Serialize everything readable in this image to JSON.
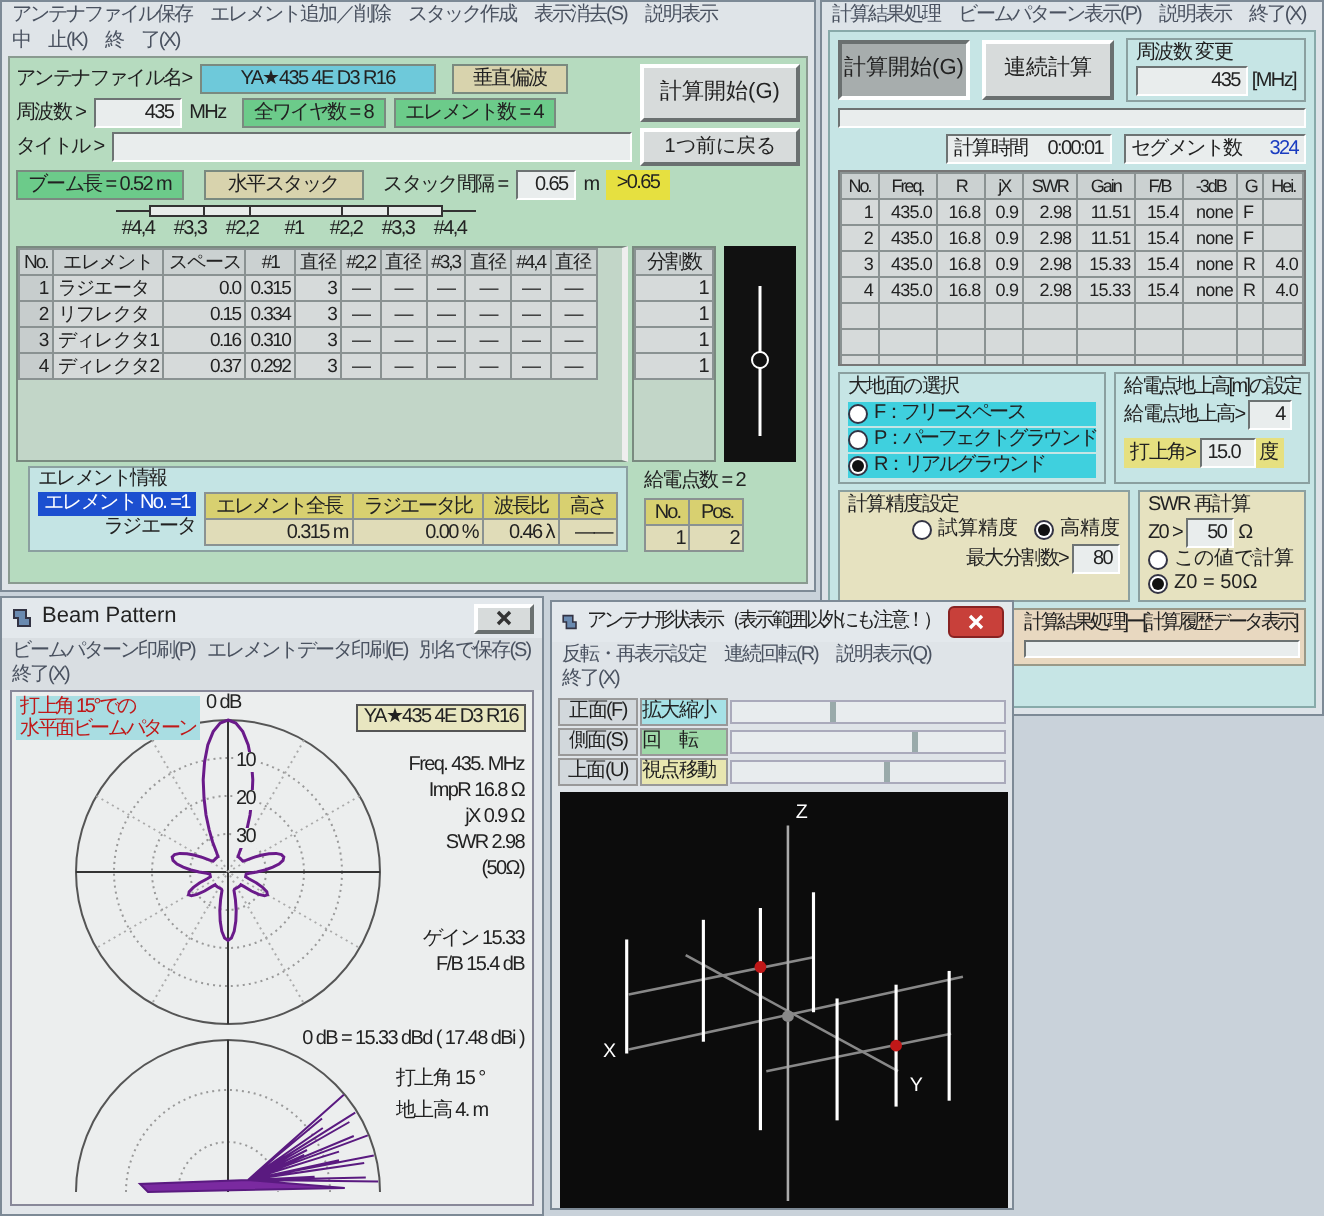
{
  "main_window": {
    "menu": [
      "アンテナファイル保存",
      "エレメント追加／削除",
      "スタック作成",
      "表示消去(S)",
      "説明表示",
      "中　止(K)",
      "終　了(X)"
    ],
    "file": {
      "label": "アンテナファイル名>",
      "value": "YA★435 4E D3 R16"
    },
    "polarization": "垂直偏波",
    "frequency": {
      "label": "周波数 >",
      "value": "435",
      "unit": "MHz"
    },
    "wire_count": "全ワイヤ数 = 8",
    "element_count": "エレメント数 = 4",
    "title_label": "タイトル >",
    "buttons": [
      "計算開始(G)",
      "1つ前に戻る"
    ],
    "boom": "ブーム長 = 0.52 m",
    "stack_type": "水平スタック",
    "stack_spacing": {
      "label": "スタック間隔 =",
      "value": "0.65",
      "unit": "m",
      "ratio": ">0.65"
    },
    "layout_labels": [
      "#4,4",
      "#3,3",
      "#2,2",
      "#1",
      "#2,2",
      "#3,3",
      "#4,4"
    ],
    "elements_table": {
      "columns": [
        "No.",
        "エレメント",
        "スペース",
        "#1",
        "直径",
        "#2,2",
        "直径",
        "#3,3",
        "直径",
        "#4,4",
        "直径"
      ],
      "rows": [
        [
          "1",
          "ラジエータ",
          "0.0",
          "0.315",
          "3",
          "—",
          "—",
          "—",
          "—",
          "—",
          "—"
        ],
        [
          "2",
          "リフレクタ",
          "0.15",
          "0.334",
          "3",
          "—",
          "—",
          "—",
          "—",
          "—",
          "—"
        ],
        [
          "3",
          "ディレクタ1",
          "0.16",
          "0.310",
          "3",
          "—",
          "—",
          "—",
          "—",
          "—",
          "—"
        ],
        [
          "4",
          "ディレクタ2",
          "0.37",
          "0.292",
          "3",
          "—",
          "—",
          "—",
          "—",
          "—",
          "—"
        ]
      ]
    },
    "segments": {
      "heading": "分割数",
      "values": [
        "1",
        "1",
        "1",
        "1"
      ]
    },
    "element_info": {
      "title": "エレメント情報",
      "number": "エレメント No. =1",
      "name": "ラジエータ",
      "columns": [
        "エレメント全長",
        "ラジエータ比",
        "波長比",
        "高さ"
      ],
      "values": [
        "0.315 m",
        "0.00 %",
        "0.46 λ",
        "——"
      ]
    },
    "feed": {
      "count": "給電点数 = 2",
      "columns": [
        "No.",
        "Pos."
      ],
      "rows": [
        [
          "1",
          "2"
        ]
      ]
    }
  },
  "results_window": {
    "menu": [
      "計算結果処理",
      "ビームパターン表示(P)",
      "説明表示",
      "終了(X)"
    ],
    "buttons": [
      {
        "label": "計算開始(G)",
        "pressed": true
      },
      {
        "label": "連続計算",
        "pressed": false
      }
    ],
    "frequency_change": {
      "title": "周波数 変更",
      "value": "435",
      "unit": "[MHz]"
    },
    "calc_time": {
      "label": "計算時間",
      "value": "0:00:01"
    },
    "segment_count": {
      "label": "セグメント数",
      "value": "324"
    },
    "table": {
      "columns": [
        "No.",
        "Freq.",
        "R",
        "jX",
        "SWR",
        "Gain",
        "F/B",
        "-3dB",
        "G",
        "Hei."
      ],
      "rows": [
        [
          "1",
          "435.0",
          "16.8",
          "0.9",
          "2.98",
          "11.51",
          "15.4",
          "none",
          "F",
          ""
        ],
        [
          "2",
          "435.0",
          "16.8",
          "0.9",
          "2.98",
          "11.51",
          "15.4",
          "none",
          "F",
          ""
        ],
        [
          "3",
          "435.0",
          "16.8",
          "0.9",
          "2.98",
          "15.33",
          "15.4",
          "none",
          "R",
          "4.0"
        ],
        [
          "4",
          "435.0",
          "16.8",
          "0.9",
          "2.98",
          "15.33",
          "15.4",
          "none",
          "R",
          "4.0"
        ]
      ]
    },
    "ground": {
      "title": "大地面の選択",
      "options": [
        {
          "label": "F：フリースペース",
          "selected": false
        },
        {
          "label": "P：パーフェクトグラウンド",
          "selected": false
        },
        {
          "label": "R：リアルグラウンド",
          "selected": true
        }
      ]
    },
    "feed_height": {
      "title": "給電点地上高[m]の設定",
      "label": "給電点地上高>",
      "value": "4",
      "angle_label": "打上角>",
      "angle_value": "15.0",
      "angle_unit": "度"
    },
    "precision": {
      "title": "計算精度設定",
      "options": [
        {
          "label": "試算精度",
          "selected": false
        },
        {
          "label": "高精度",
          "selected": true
        }
      ],
      "max_label": "最大分割数>",
      "max_value": "80"
    },
    "swr": {
      "title": "SWR 再計算",
      "z0_label": "Z0 >",
      "z0_value": "50",
      "z0_unit": "Ω",
      "options": [
        {
          "label": "この値で計算",
          "selected": false
        },
        {
          "label": "Z0 = 50Ω",
          "selected": true
        }
      ]
    },
    "history": "計算結果処理]ー[計算履歴データ表示]"
  },
  "beam_window": {
    "title": "Beam Pattern",
    "menu": [
      "ビームパターン印刷(P)",
      "エレメントデータ印刷(E)",
      "別名で保存(S)",
      "終了(X)"
    ],
    "caption": [
      "打上角 15°での",
      "水平面ビームパターン"
    ],
    "antenna": "YA★435 4E D3 R16",
    "ticks": [
      "0 dB",
      "10",
      "20",
      "30"
    ],
    "stats": [
      "Freq. 435. MHz",
      "ImpR 16.8 Ω",
      "jX 0.9 Ω",
      "SWR 2.98",
      "(50Ω)"
    ],
    "gain": "ゲイン 15.33",
    "fb": "F/B 15.4 dB",
    "reference": "0 dB = 15.33 dBd ( 17.48 dBi )",
    "elevation": "打上角 15 °",
    "height": "地上高 4. m"
  },
  "shape_window": {
    "title": "アンテナ形状表示（表示範囲以外にも注意！）",
    "menu": [
      "反転・再表示設定",
      "連続回転(R)",
      "説明表示(Q)",
      "終了(X)"
    ],
    "sliders": [
      {
        "label": "正面(F)",
        "mode": "拡大縮小",
        "color": "#a6e2e6",
        "level": 0.36
      },
      {
        "label": "側面(S)",
        "mode": "回　転",
        "color": "#9ed8a8",
        "level": 0.66
      },
      {
        "label": "上面(U)",
        "mode": "視点移動",
        "color": "#e8e6b0",
        "level": 0.56
      }
    ],
    "axes": [
      "Z",
      "X",
      "Y"
    ]
  }
}
